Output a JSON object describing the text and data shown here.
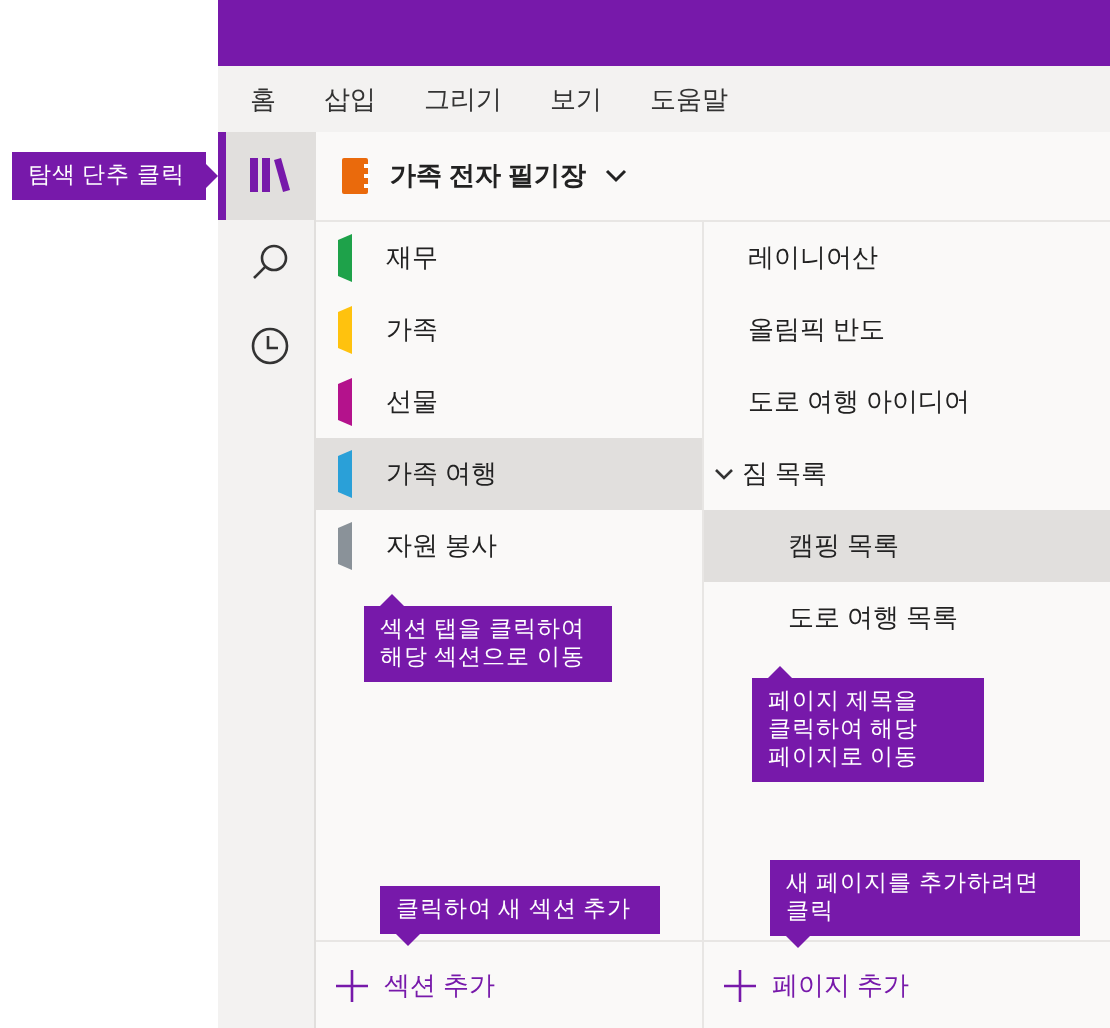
{
  "menu": [
    {
      "label": "홈"
    },
    {
      "label": "삽입"
    },
    {
      "label": "그리기"
    },
    {
      "label": "보기"
    },
    {
      "label": "도움말"
    }
  ],
  "notebook": {
    "title": "가족 전자 필기장"
  },
  "sections": [
    {
      "label": "재무",
      "color": "#1ea24a",
      "selected": false
    },
    {
      "label": "가족",
      "color": "#ffc20e",
      "selected": false
    },
    {
      "label": "선물",
      "color": "#b4128c",
      "selected": false
    },
    {
      "label": "가족 여행",
      "color": "#2aa0d8",
      "selected": true
    },
    {
      "label": "자원 봉사",
      "color": "#8a9299",
      "selected": false
    }
  ],
  "pages": [
    {
      "label": "레이니어산",
      "selected": false
    },
    {
      "label": "올림픽 반도",
      "selected": false
    },
    {
      "label": "도로 여행 아이디어",
      "selected": false
    },
    {
      "label": "짐 목록",
      "selected": false,
      "expanded": true,
      "children": [
        {
          "label": "캠핑 목록",
          "selected": true
        },
        {
          "label": "도로 여행 목록",
          "selected": false
        }
      ]
    }
  ],
  "add_section": "섹션 추가",
  "add_page": "페이지 추가",
  "callouts": {
    "nav": "탐색 단추 클릭",
    "section_tab": "섹션 탭을 클릭하여 해당 섹션으로 이동",
    "page_title": "페이지 제목을 클릭하여 해당 페이지로 이동",
    "new_section": "클릭하여 새 섹션 추가",
    "new_page": "새 페이지를 추가하려면 클릭"
  }
}
